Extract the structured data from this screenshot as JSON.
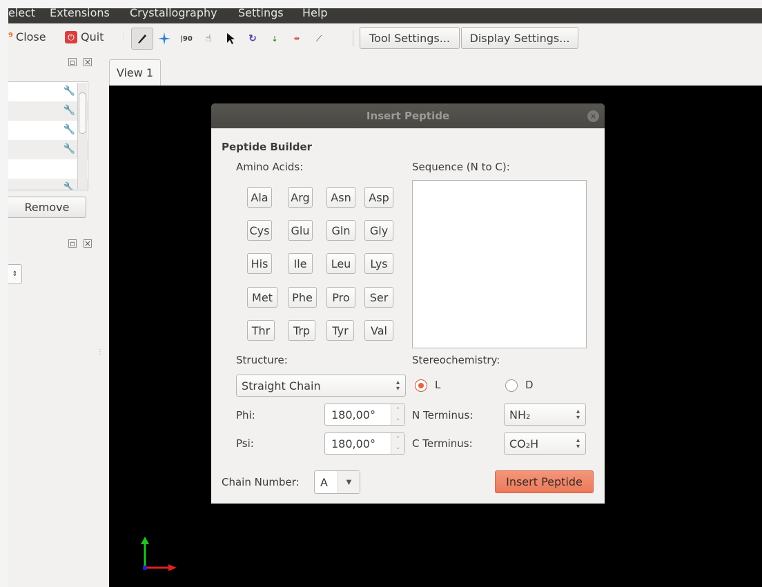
{
  "menubar": {
    "items": [
      "elect",
      "Extensions",
      "Crystallography",
      "Settings",
      "Help"
    ]
  },
  "toolbar": {
    "close_label": "Close",
    "quit_label": "Quit",
    "tool_settings_label": "Tool Settings...",
    "display_settings_label": "Display Settings...",
    "icons": [
      "draw-pen-icon",
      "navigate-icon",
      "measure-icon",
      "manipulate-hand-icon",
      "select-arrow-icon",
      "auto-rotate-icon",
      "bond-centric-icon",
      "align-icon",
      "symmetry-icon"
    ]
  },
  "left_panel": {
    "remove_label": "Remove"
  },
  "view": {
    "tab_label": "View 1"
  },
  "dialog": {
    "title": "Insert Peptide",
    "section_title": "Peptide Builder",
    "amino_acids_label": "Amino Acids:",
    "sequence_label": "Sequence (N to C):",
    "amino_acids": [
      [
        "Ala",
        "Arg",
        "Asn",
        "Asp"
      ],
      [
        "Cys",
        "Glu",
        "Gln",
        "Gly"
      ],
      [
        "His",
        "Ile",
        "Leu",
        "Lys"
      ],
      [
        "Met",
        "Phe",
        "Pro",
        "Ser"
      ],
      [
        "Thr",
        "Trp",
        "Tyr",
        "Val"
      ]
    ],
    "sequence_value": "",
    "structure_label": "Structure:",
    "structure_value": "Straight Chain",
    "stereo_label": "Stereochemistry:",
    "stereo_l": "L",
    "stereo_d": "D",
    "stereo_selected": "L",
    "phi_label": "Phi:",
    "phi_value": "180,00°",
    "psi_label": "Psi:",
    "psi_value": "180,00°",
    "n_term_label": "N Terminus:",
    "n_term_value": "NH₂",
    "c_term_label": "C Terminus:",
    "c_term_value": "CO₂H",
    "chain_label": "Chain Number:",
    "chain_value": "A",
    "insert_label": "Insert Peptide"
  },
  "colors": {
    "accent": "#ec7a5a",
    "menubar": "#3b3a37",
    "titlebar": "#4a4844",
    "canvas": "#000000"
  }
}
